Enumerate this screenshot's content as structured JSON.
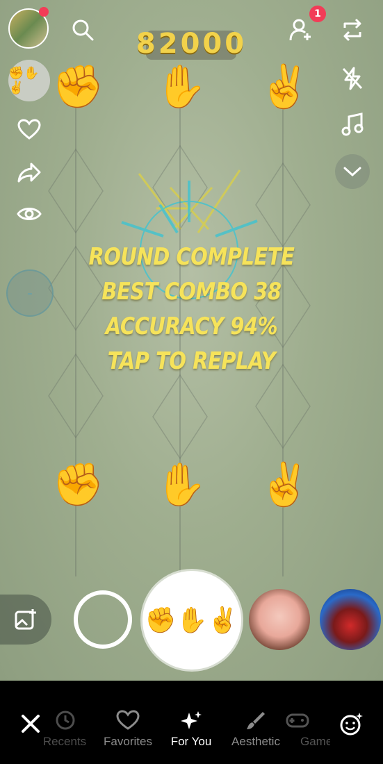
{
  "score": "82000",
  "message": [
    "ROUND COMPLETE",
    "BEST COMBO 38",
    "ACCURACY 94%",
    "TAP TO REPLAY"
  ],
  "hands_top": [
    "✊",
    "✋",
    "✌️"
  ],
  "hands_bottom": [
    "✊",
    "✋",
    "✌️"
  ],
  "notifications_count": "1",
  "side_circle_label": "-",
  "active_lens_icon": "✊✋✌️",
  "lens_thumb_icon": "✊✋✌️",
  "icons": {
    "search": "search-icon",
    "add_friend": "add-friend-icon",
    "flip": "flip-camera-icon",
    "flash": "flash-off-icon",
    "music": "music-icon",
    "chevron": "chevron-down-icon",
    "heart": "heart-icon",
    "share": "share-icon",
    "eye": "eye-icon"
  },
  "tabs": [
    {
      "label": "Recents",
      "icon": "history-icon"
    },
    {
      "label": "Favorites",
      "icon": "heart-icon"
    },
    {
      "label": "For You",
      "icon": "sparkles-icon"
    },
    {
      "label": "Aesthetic",
      "icon": "brush-icon"
    },
    {
      "label": "Games",
      "icon": "gamepad-icon"
    }
  ],
  "colors": {
    "accent_badge": "#f23c57",
    "score": "#f2d24b",
    "message": "#f6e35a"
  }
}
